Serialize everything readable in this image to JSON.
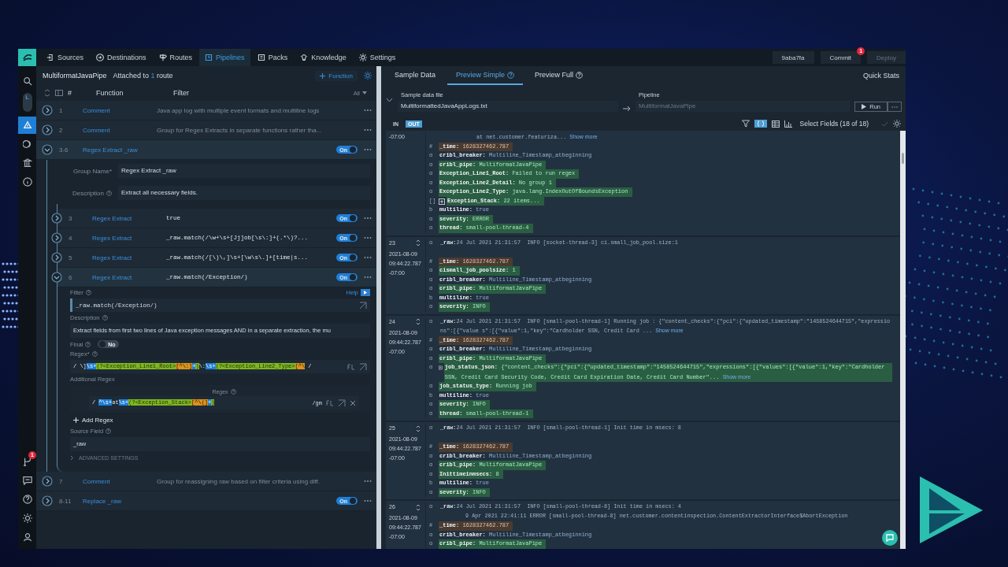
{
  "nav": {
    "items": [
      {
        "label": "Sources",
        "selected": false
      },
      {
        "label": "Destinations",
        "selected": false
      },
      {
        "label": "Routes",
        "selected": false
      },
      {
        "label": "Pipelines",
        "selected": true
      },
      {
        "label": "Packs",
        "selected": false
      },
      {
        "label": "Knowledge",
        "selected": false
      },
      {
        "label": "Settings",
        "selected": false
      }
    ],
    "version": "9aba7fa",
    "commit": "Commit",
    "commit_badge": "1",
    "deploy": "Deploy",
    "deploy_disabled": true
  },
  "rail": {
    "workspace": "L",
    "top": [
      {
        "selected": false
      },
      {
        "selected": true
      },
      {
        "selected": false
      },
      {
        "selected": false
      },
      {
        "selected": false
      }
    ],
    "bottom": [
      {
        "selected": false,
        "badge": "1"
      },
      {
        "selected": false
      },
      {
        "selected": false
      },
      {
        "selected": false
      },
      {
        "selected": false
      }
    ]
  },
  "pipeline": {
    "name": "MultiformatJavaPipe",
    "attached_prefix": "Attached to",
    "attached_count": "1",
    "attached_suffix": "route",
    "add_function": "Function",
    "columns": [
      "#",
      "Function",
      "Filter"
    ],
    "all_filter": "All",
    "functions": [
      {
        "kind": "comment",
        "number": "1",
        "name": "Comment",
        "filter": "Java app log with multiple event formats and multiline logs",
        "expanded": false
      },
      {
        "kind": "comment",
        "number": "2",
        "name": "Comment",
        "filter": "Group for Regex Extracts in separate functions rather tha...",
        "expanded": false
      },
      {
        "kind": "group",
        "number": "3-6",
        "name": "Regex Extract _raw",
        "expanded": true,
        "on": true,
        "toggle_label": "On",
        "group_name_label": "Group Name*",
        "group_name": "Regex Extract _raw",
        "description_label": "Description",
        "description": "Extract all necessary fields.",
        "children": [
          {
            "kind": "function",
            "number": "3",
            "name": "Regex Extract",
            "filter": "true",
            "on": true,
            "toggle_label": "On",
            "expanded": false
          },
          {
            "kind": "function",
            "number": "4",
            "name": "Regex Extract",
            "filter": "_raw.match(/\\w+\\s+[Jj]ob[\\s\\:]+(.*\\)?...",
            "on": true,
            "toggle_label": "On",
            "expanded": false
          },
          {
            "kind": "function",
            "number": "5",
            "name": "Regex Extract",
            "filter": "_raw.match(/[\\)\\,]\\s+[\\w\\s\\.]+[time|s...",
            "on": true,
            "toggle_label": "On",
            "expanded": false
          },
          {
            "kind": "function",
            "number": "6",
            "name": "Regex Extract",
            "filter": "_raw.match(/Exception/)",
            "on": true,
            "toggle_label": "On",
            "expanded": true,
            "details": {
              "filter_label": "Filter",
              "help": "Help",
              "filter_value": "_raw.match(/Exception/)",
              "description_label": "Description",
              "description": "Extract fields from first two lines of Java exception messages AND in a separate extraction, the mu",
              "final_label": "Final",
              "final_toggle": "No",
              "final": false,
              "regex_label": "Regex*",
              "regex_open": "/",
              "regex_close": "/",
              "regex": [
                {
                  "text": "\\]",
                  "kind": "plain"
                },
                {
                  "text": "\\s+",
                  "kind": "quant"
                },
                {
                  "text": "(?<Exception_Line1_Root>",
                  "kind": "group"
                },
                {
                  "text": "[^\\:]",
                  "kind": "class"
                },
                {
                  "text": "+",
                  "kind": "quant"
                },
                {
                  "text": ")",
                  "kind": "group"
                },
                {
                  "text": "\\:",
                  "kind": "plain"
                },
                {
                  "text": "\\s+",
                  "kind": "quant"
                },
                {
                  "text": "(?<Exception_Line2_Type>",
                  "kind": "group"
                },
                {
                  "text": "[^\\",
                  "kind": "class"
                }
              ],
              "additional_label": "Additional Regex",
              "additional_header": "Regex",
              "additional": [
                {
                  "open": "/",
                  "flags": "/gm",
                  "segments": [
                    {
                      "text": "^\\s+",
                      "kind": "quant"
                    },
                    {
                      "text": "at",
                      "kind": "plain"
                    },
                    {
                      "text": "\\s+",
                      "kind": "quant"
                    },
                    {
                      "text": "(?<Exception_Stack>",
                      "kind": "group"
                    },
                    {
                      "text": "[^\\(]",
                      "kind": "class"
                    },
                    {
                      "text": "+",
                      "kind": "quant"
                    },
                    {
                      "text": ")",
                      "kind": "group"
                    }
                  ]
                }
              ],
              "add_regex": "Add Regex",
              "source_label": "Source Field",
              "source_value": "_raw",
              "advanced": "ADVANCED SETTINGS"
            }
          }
        ]
      },
      {
        "kind": "comment",
        "number": "7",
        "name": "Comment",
        "filter": "Group for reassigning raw based on filter criteria using diff.",
        "expanded": false
      },
      {
        "kind": "group",
        "number": "8-11",
        "name": "Replace _raw",
        "expanded": false,
        "on": true,
        "toggle_label": "On"
      }
    ]
  },
  "preview": {
    "tabs": [
      {
        "label": "Sample Data",
        "selected": false,
        "help": false
      },
      {
        "label": "Preview Simple",
        "selected": true,
        "help": true
      },
      {
        "label": "Preview Full",
        "selected": false,
        "help": true
      }
    ],
    "quick_stats": "Quick Stats",
    "sample_label": "Sample data file",
    "sample_file": "MultiformattedJavaAppLogs.txt",
    "pipeline_label": "Pipeline",
    "pipeline_value": "MultiformatJavaPipe",
    "run": "Run",
    "modes": [
      {
        "label": "IN",
        "selected": false
      },
      {
        "label": "OUT",
        "selected": true
      }
    ],
    "select_fields": "Select Fields (18 of 18)",
    "events": [
      {
        "timestamp": [
          "-07:00"
        ],
        "raw": [
          "at net.customer.featuriza..."
        ],
        "show_more": "Show more",
        "fields": [
          {
            "type": "#",
            "name": "_time:",
            "value": "1628327462.787",
            "kind": "modified"
          },
          {
            "type": "α",
            "name": "cribl_breaker:",
            "value": "Multiline_Timestamp_atbeginning",
            "kind": "plain"
          },
          {
            "type": "α",
            "name": "cribl_pipe:",
            "value": "MultiformatJavaPipe",
            "kind": "added"
          },
          {
            "type": "α",
            "name": "Exception_Line1_Root:",
            "value": "Failed to run regex",
            "kind": "added"
          },
          {
            "type": "α",
            "name": "Exception_Line2_Detail:",
            "value": "No group 1",
            "kind": "added"
          },
          {
            "type": "α",
            "name": "Exception_Line2_Type:",
            "value": "java.lang.IndexOutOfBoundsException",
            "kind": "added"
          },
          {
            "type": "[]",
            "name": "Exception_Stack:",
            "value": "22 items...",
            "kind": "added",
            "expandable": true
          },
          {
            "type": "b",
            "name": "multiline:",
            "value": "true",
            "kind": "plain"
          },
          {
            "type": "α",
            "name": "severity:",
            "value": "ERROR",
            "kind": "added"
          },
          {
            "type": "α",
            "name": "thread:",
            "value": "small-pool-thread-4",
            "kind": "added"
          }
        ]
      },
      {
        "number": "23",
        "timestamp": [
          "2021-08-09",
          "09:44:22.787",
          "-07:00"
        ],
        "raw_key": "_raw:",
        "raw_type": "α",
        "raw": [
          "24 Jul 2021 21:31:57  INFO [socket-thread-3] ci.small_job_pool.size:1"
        ],
        "fields": [
          {
            "type": "#",
            "name": "_time:",
            "value": "1628327462.787",
            "kind": "modified"
          },
          {
            "type": "α",
            "name": "cismall_job_poolsize:",
            "value": "1",
            "kind": "added"
          },
          {
            "type": "α",
            "name": "cribl_breaker:",
            "value": "Multiline_Timestamp_atbeginning",
            "kind": "plain"
          },
          {
            "type": "α",
            "name": "cribl_pipe:",
            "value": "MultiformatJavaPipe",
            "kind": "added"
          },
          {
            "type": "b",
            "name": "multiline:",
            "value": "true",
            "kind": "plain"
          },
          {
            "type": "α",
            "name": "severity:",
            "value": "INFO",
            "kind": "added"
          }
        ]
      },
      {
        "number": "24",
        "timestamp": [
          "2021-08-09",
          "09:44:22.787",
          "-07:00"
        ],
        "raw_key": "_raw:",
        "raw_type": "α",
        "raw": [
          "24 Jul 2021 21:31:57  INFO [small-pool-thread-1] Running job : {\"content_checks\":{\"pci\":{\"updated_timestamp\":\"1458524644715\",\"expressions\":[{\"value s\":[{\"value\":1,\"key\":\"Cardholder SSN, Credit Card ..."
        ],
        "show_more": "Show more",
        "fields": [
          {
            "type": "#",
            "name": "_time:",
            "value": "1628327462.787",
            "kind": "modified"
          },
          {
            "type": "α",
            "name": "cribl_breaker:",
            "value": "Multiline_Timestamp_atbeginning",
            "kind": "plain"
          },
          {
            "type": "α",
            "name": "cribl_pipe:",
            "value": "MultiformatJavaPipe",
            "kind": "added"
          },
          {
            "type": "α",
            "name": "job_status_json:",
            "value": "{\"content_checks\":{\"pci\":{\"updated_timestamp\":\"1458524644715\",\"expressions\":[{\"values\":[{\"value\":1,\"key\":\"Cardholder SSN, Credit Card Security Code, Credit Card Expiration Date, Credit Card Number\"...",
            "kind": "added",
            "expandable": true,
            "show_more": "Show more"
          },
          {
            "type": "α",
            "name": "job_status_type:",
            "value": "Running job",
            "kind": "added"
          },
          {
            "type": "b",
            "name": "multiline:",
            "value": "true",
            "kind": "plain"
          },
          {
            "type": "α",
            "name": "severity:",
            "value": "INFO",
            "kind": "added"
          },
          {
            "type": "α",
            "name": "thread:",
            "value": "small-pool-thread-1",
            "kind": "added"
          }
        ]
      },
      {
        "number": "25",
        "timestamp": [
          "2021-08-09",
          "09:44:22.787",
          "-07:00"
        ],
        "raw_key": "_raw:",
        "raw_type": "α",
        "raw": [
          "24 Jul 2021 21:31:57  INFO [small-pool-thread-1] Init time in msecs: 8"
        ],
        "fields": [
          {
            "type": "#",
            "name": "_time:",
            "value": "1628327462.787",
            "kind": "modified"
          },
          {
            "type": "α",
            "name": "cribl_breaker:",
            "value": "Multiline_Timestamp_atbeginning",
            "kind": "plain"
          },
          {
            "type": "α",
            "name": "cribl_pipe:",
            "value": "MultiformatJavaPipe",
            "kind": "added"
          },
          {
            "type": "α",
            "name": "Inittimeinmsecs:",
            "value": "8",
            "kind": "added"
          },
          {
            "type": "b",
            "name": "multiline:",
            "value": "true",
            "kind": "plain"
          },
          {
            "type": "α",
            "name": "severity:",
            "value": "INFO",
            "kind": "added"
          }
        ]
      },
      {
        "number": "26",
        "timestamp": [
          "2021-08-09",
          "09:44:22.787",
          "-07:00"
        ],
        "raw_key": "_raw:",
        "raw_type": "α",
        "raw": [
          "24 Jul 2021 21:31:57  INFO [small-pool-thread-8] Init time in msecs: 4",
          "9 Apr 2021 22:41:11 ERROR [small-pool-thread-8] net.customer.contentinspection.ContentExtractorInterface$AbortException"
        ],
        "fields": [
          {
            "type": "#",
            "name": "_time:",
            "value": "1628327462.787",
            "kind": "modified"
          },
          {
            "type": "α",
            "name": "cribl_breaker:",
            "value": "Multiline_Timestamp_atbeginning",
            "kind": "plain"
          },
          {
            "type": "α",
            "name": "cribl_pipe:",
            "value": "MultiformatJavaPipe",
            "kind": "added"
          }
        ]
      }
    ]
  }
}
